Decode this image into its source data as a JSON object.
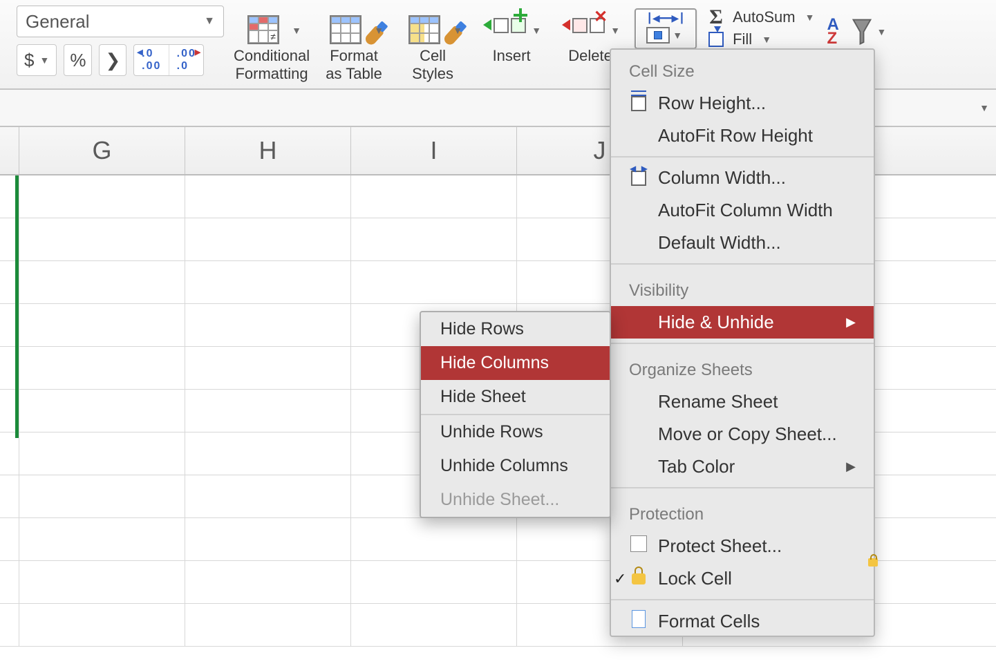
{
  "ribbon": {
    "number_format": "General",
    "currency_label": "$",
    "percent_label": "%",
    "comma_label": "❯",
    "inc_decimal_label": ".0",
    "dec_decimal_label": ".00",
    "conditional_formatting_l1": "Conditional",
    "conditional_formatting_l2": "Formatting",
    "format_as_table_l1": "Format",
    "format_as_table_l2": "as Table",
    "cell_styles_l1": "Cell",
    "cell_styles_l2": "Styles",
    "insert_label": "Insert",
    "delete_label": "Delete",
    "autosum_label": "AutoSum",
    "fill_label": "Fill"
  },
  "columns": [
    "G",
    "H",
    "I",
    "J"
  ],
  "format_menu": {
    "section_cell_size": "Cell Size",
    "row_height": "Row Height...",
    "autofit_row_height": "AutoFit Row Height",
    "column_width": "Column Width...",
    "autofit_column_width": "AutoFit Column Width",
    "default_width": "Default Width...",
    "section_visibility": "Visibility",
    "hide_unhide": "Hide & Unhide",
    "section_organize": "Organize Sheets",
    "rename_sheet": "Rename Sheet",
    "move_or_copy": "Move or Copy Sheet...",
    "tab_color": "Tab Color",
    "section_protection": "Protection",
    "protect_sheet": "Protect Sheet...",
    "lock_cell": "Lock Cell",
    "format_cells": "Format Cells"
  },
  "hide_submenu": {
    "hide_rows": "Hide Rows",
    "hide_columns": "Hide Columns",
    "hide_sheet": "Hide Sheet",
    "unhide_rows": "Unhide Rows",
    "unhide_columns": "Unhide Columns",
    "unhide_sheet": "Unhide Sheet..."
  }
}
